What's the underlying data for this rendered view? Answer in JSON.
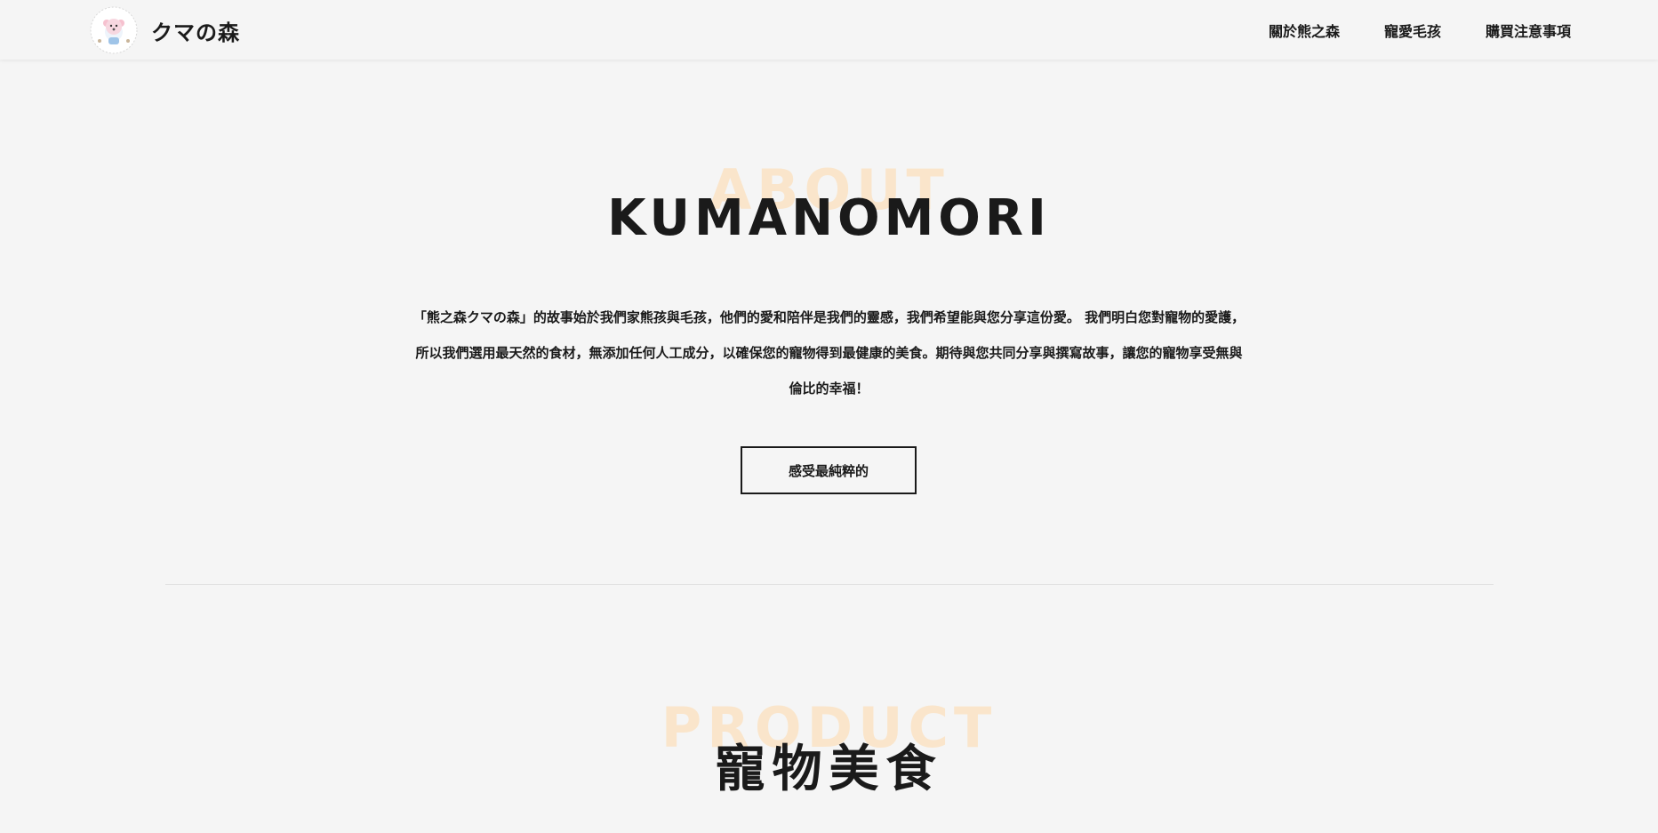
{
  "navbar": {
    "brand_name": "クマの森",
    "links": [
      {
        "label": "關於熊之森"
      },
      {
        "label": "寵愛毛孩"
      },
      {
        "label": "購買注意事項"
      }
    ]
  },
  "about": {
    "bg_word": "ABOUT",
    "title": "KUMANOMORI",
    "description": "「熊之森クマの森」的故事始於我們家熊孩與毛孩，他們的愛和陪伴是我們的靈感，我們希望能與您分享這份愛。 我們明白您對寵物的愛護，所以我們選用最天然的食材，無添加任何人工成分，以確保您的寵物得到最健康的美食。期待與您共同分享與撰寫故事，讓您的寵物享受無與倫比的幸福！",
    "cta_label": "感受最純粹的"
  },
  "product": {
    "bg_word": "PRODUCT",
    "title": "寵物美食"
  },
  "colors": {
    "background": "#f5f5f5",
    "text": "#1a1a1a",
    "accent_faded": "#fbe3c4"
  }
}
